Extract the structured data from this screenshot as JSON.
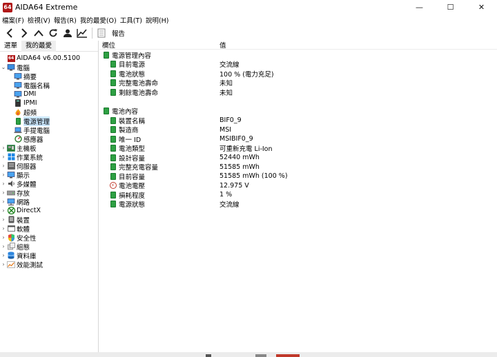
{
  "window": {
    "logo": "64",
    "title": "AIDA64 Extreme",
    "controls": [
      "—",
      "☐",
      "✕"
    ]
  },
  "menu": [
    "檔案(F)",
    "檢視(V)",
    "報告(R)",
    "我的最愛(O)",
    "工具(T)",
    "說明(H)"
  ],
  "toolbar": {
    "report_label": "報告",
    "icons": [
      "back-icon",
      "forward-icon",
      "up-icon",
      "refresh-icon",
      "user-icon",
      "chart-icon",
      "report-icon"
    ]
  },
  "left_tabs": [
    "選單",
    "我的最愛"
  ],
  "tree": [
    {
      "label": "AIDA64 v6.00.5100",
      "level": 0,
      "expander": "",
      "icon": "aida-logo-icon"
    },
    {
      "label": "電腦",
      "level": 0,
      "expander": "⌄",
      "icon": "computer-icon"
    },
    {
      "label": "摘要",
      "level": 1,
      "expander": "",
      "icon": "summary-icon"
    },
    {
      "label": "電腦名稱",
      "level": 1,
      "expander": "",
      "icon": "computer-name-icon"
    },
    {
      "label": "DMI",
      "level": 1,
      "expander": "",
      "icon": "dmi-icon"
    },
    {
      "label": "IPMI",
      "level": 1,
      "expander": "",
      "icon": "ipmi-icon"
    },
    {
      "label": "超頻",
      "level": 1,
      "expander": "",
      "icon": "flame-icon"
    },
    {
      "label": "電源管理",
      "level": 1,
      "expander": "",
      "icon": "power-icon",
      "selected": true
    },
    {
      "label": "手提電腦",
      "level": 1,
      "expander": "",
      "icon": "laptop-icon"
    },
    {
      "label": "感應器",
      "level": 1,
      "expander": "",
      "icon": "sensor-icon"
    },
    {
      "label": "主機板",
      "level": 0,
      "expander": "›",
      "icon": "motherboard-icon"
    },
    {
      "label": "作業系統",
      "level": 0,
      "expander": "›",
      "icon": "windows-icon"
    },
    {
      "label": "伺服器",
      "level": 0,
      "expander": "›",
      "icon": "server-icon"
    },
    {
      "label": "顯示",
      "level": 0,
      "expander": "›",
      "icon": "display-icon"
    },
    {
      "label": "多媒體",
      "level": 0,
      "expander": "›",
      "icon": "multimedia-icon"
    },
    {
      "label": "存放",
      "level": 0,
      "expander": "›",
      "icon": "storage-icon"
    },
    {
      "label": "網路",
      "level": 0,
      "expander": "›",
      "icon": "network-icon"
    },
    {
      "label": "DirectX",
      "level": 0,
      "expander": "›",
      "icon": "xbox-icon"
    },
    {
      "label": "裝置",
      "level": 0,
      "expander": "›",
      "icon": "device-icon"
    },
    {
      "label": "軟體",
      "level": 0,
      "expander": "›",
      "icon": "software-icon"
    },
    {
      "label": "安全性",
      "level": 0,
      "expander": "›",
      "icon": "shield-icon"
    },
    {
      "label": "組態",
      "level": 0,
      "expander": "›",
      "icon": "config-icon"
    },
    {
      "label": "資料庫",
      "level": 0,
      "expander": "›",
      "icon": "database-icon"
    },
    {
      "label": "效能測試",
      "level": 0,
      "expander": "›",
      "icon": "benchmark-icon"
    }
  ],
  "columns": {
    "field": "欄位",
    "value": "值"
  },
  "sections": [
    {
      "title": "電源管理內容",
      "items": [
        {
          "field": "目前電源",
          "value": "交流線",
          "icon": "battery-icon"
        },
        {
          "field": "電池狀態",
          "value": "100 % (電力充足)",
          "icon": "battery-icon"
        },
        {
          "field": "完整電池壽命",
          "value": "未知",
          "icon": "battery-icon"
        },
        {
          "field": "剩餘電池壽命",
          "value": "未知",
          "icon": "battery-icon"
        }
      ]
    },
    {
      "title": "電池內容",
      "items": [
        {
          "field": "裝置名稱",
          "value": "BIF0_9",
          "icon": "battery-icon"
        },
        {
          "field": "製造商",
          "value": "MSI",
          "icon": "battery-icon"
        },
        {
          "field": "唯一 ID",
          "value": "MSIBIF0_9",
          "icon": "battery-icon"
        },
        {
          "field": "電池類型",
          "value": "可重新充電 Li-Ion",
          "icon": "battery-icon"
        },
        {
          "field": "設計容量",
          "value": "52440 mWh",
          "icon": "battery-icon"
        },
        {
          "field": "完整充電容量",
          "value": "51585 mWh",
          "icon": "battery-icon"
        },
        {
          "field": "目前容量",
          "value": "51585 mWh  (100 %)",
          "icon": "battery-icon"
        },
        {
          "field": "電池電壓",
          "value": "12.975 V",
          "icon": "voltage-icon"
        },
        {
          "field": "損耗程度",
          "value": "1 %",
          "icon": "battery-icon"
        },
        {
          "field": "電源狀態",
          "value": "交流線",
          "icon": "battery-icon"
        }
      ]
    }
  ],
  "colors": {
    "selection": "#cce8ff",
    "battery_green": "#2ea043",
    "logo_red": "#b01818"
  }
}
